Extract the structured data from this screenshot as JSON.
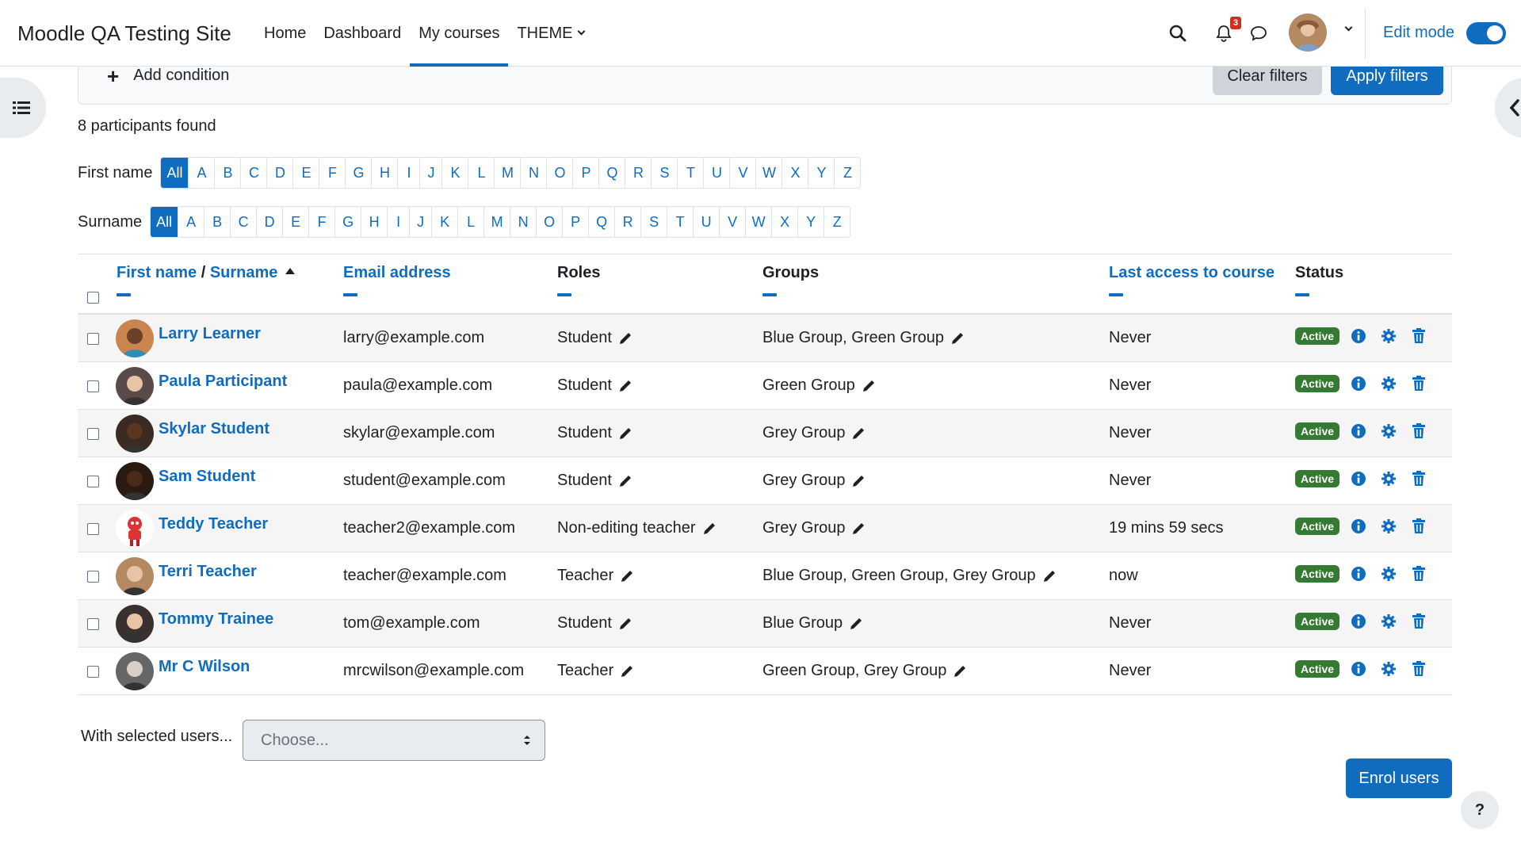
{
  "navbar": {
    "brand": "Moodle QA Testing Site",
    "links": [
      "Home",
      "Dashboard",
      "My courses",
      "THEME"
    ],
    "active_link": "My courses",
    "notification_count": "3",
    "edit_mode_label": "Edit mode",
    "edit_mode_on": true
  },
  "filters": {
    "add_condition": "Add condition",
    "clear_label": "Clear filters",
    "apply_label": "Apply filters"
  },
  "participants_found": "8 participants found",
  "first_name_bar": {
    "label": "First name",
    "letters": [
      "All",
      "A",
      "B",
      "C",
      "D",
      "E",
      "F",
      "G",
      "H",
      "I",
      "J",
      "K",
      "L",
      "M",
      "N",
      "O",
      "P",
      "Q",
      "R",
      "S",
      "T",
      "U",
      "V",
      "W",
      "X",
      "Y",
      "Z"
    ],
    "selected": "All"
  },
  "surname_bar": {
    "label": "Surname",
    "letters": [
      "All",
      "A",
      "B",
      "C",
      "D",
      "E",
      "F",
      "G",
      "H",
      "I",
      "J",
      "K",
      "L",
      "M",
      "N",
      "O",
      "P",
      "Q",
      "R",
      "S",
      "T",
      "U",
      "V",
      "W",
      "X",
      "Y",
      "Z"
    ],
    "selected": "All"
  },
  "table": {
    "headers": {
      "first_name": "First name",
      "slash": " / ",
      "surname": "Surname",
      "email": "Email address",
      "roles": "Roles",
      "groups": "Groups",
      "last_access": "Last access to course",
      "status": "Status"
    },
    "rows": [
      {
        "name": "Larry Learner",
        "email": "larry@example.com",
        "role": "Student",
        "groups": "Blue Group, Green Group",
        "last_access": "Never",
        "status": "Active"
      },
      {
        "name": "Paula Participant",
        "email": "paula@example.com",
        "role": "Student",
        "groups": "Green Group",
        "last_access": "Never",
        "status": "Active"
      },
      {
        "name": "Skylar Student",
        "email": "skylar@example.com",
        "role": "Student",
        "groups": "Grey Group",
        "last_access": "Never",
        "status": "Active"
      },
      {
        "name": "Sam Student",
        "email": "student@example.com",
        "role": "Student",
        "groups": "Grey Group",
        "last_access": "Never",
        "status": "Active"
      },
      {
        "name": "Teddy Teacher",
        "email": "teacher2@example.com",
        "role": "Non-editing teacher",
        "groups": "Grey Group",
        "last_access": "19 mins 59 secs",
        "status": "Active"
      },
      {
        "name": "Terri Teacher",
        "email": "teacher@example.com",
        "role": "Teacher",
        "groups": "Blue Group, Green Group, Grey Group",
        "last_access": "now",
        "status": "Active"
      },
      {
        "name": "Tommy Trainee",
        "email": "tom@example.com",
        "role": "Student",
        "groups": "Blue Group",
        "last_access": "Never",
        "status": "Active"
      },
      {
        "name": "Mr C Wilson",
        "email": "mrcwilson@example.com",
        "role": "Teacher",
        "groups": "Green Group, Grey Group",
        "last_access": "Never",
        "status": "Active"
      }
    ]
  },
  "bulk": {
    "label": "With selected users...",
    "select_value": "Choose..."
  },
  "enrol_label": "Enrol users",
  "help_label": "?",
  "colors": {
    "primary": "#0f6cbf",
    "active_badge": "#357a32",
    "notification": "#ca3120"
  },
  "avatar_colors": [
    "#c9844f",
    "#5a4a4a",
    "#3a2a22",
    "#2a1a12",
    "#d33",
    "#b58a62",
    "#3a3030",
    "#666"
  ]
}
